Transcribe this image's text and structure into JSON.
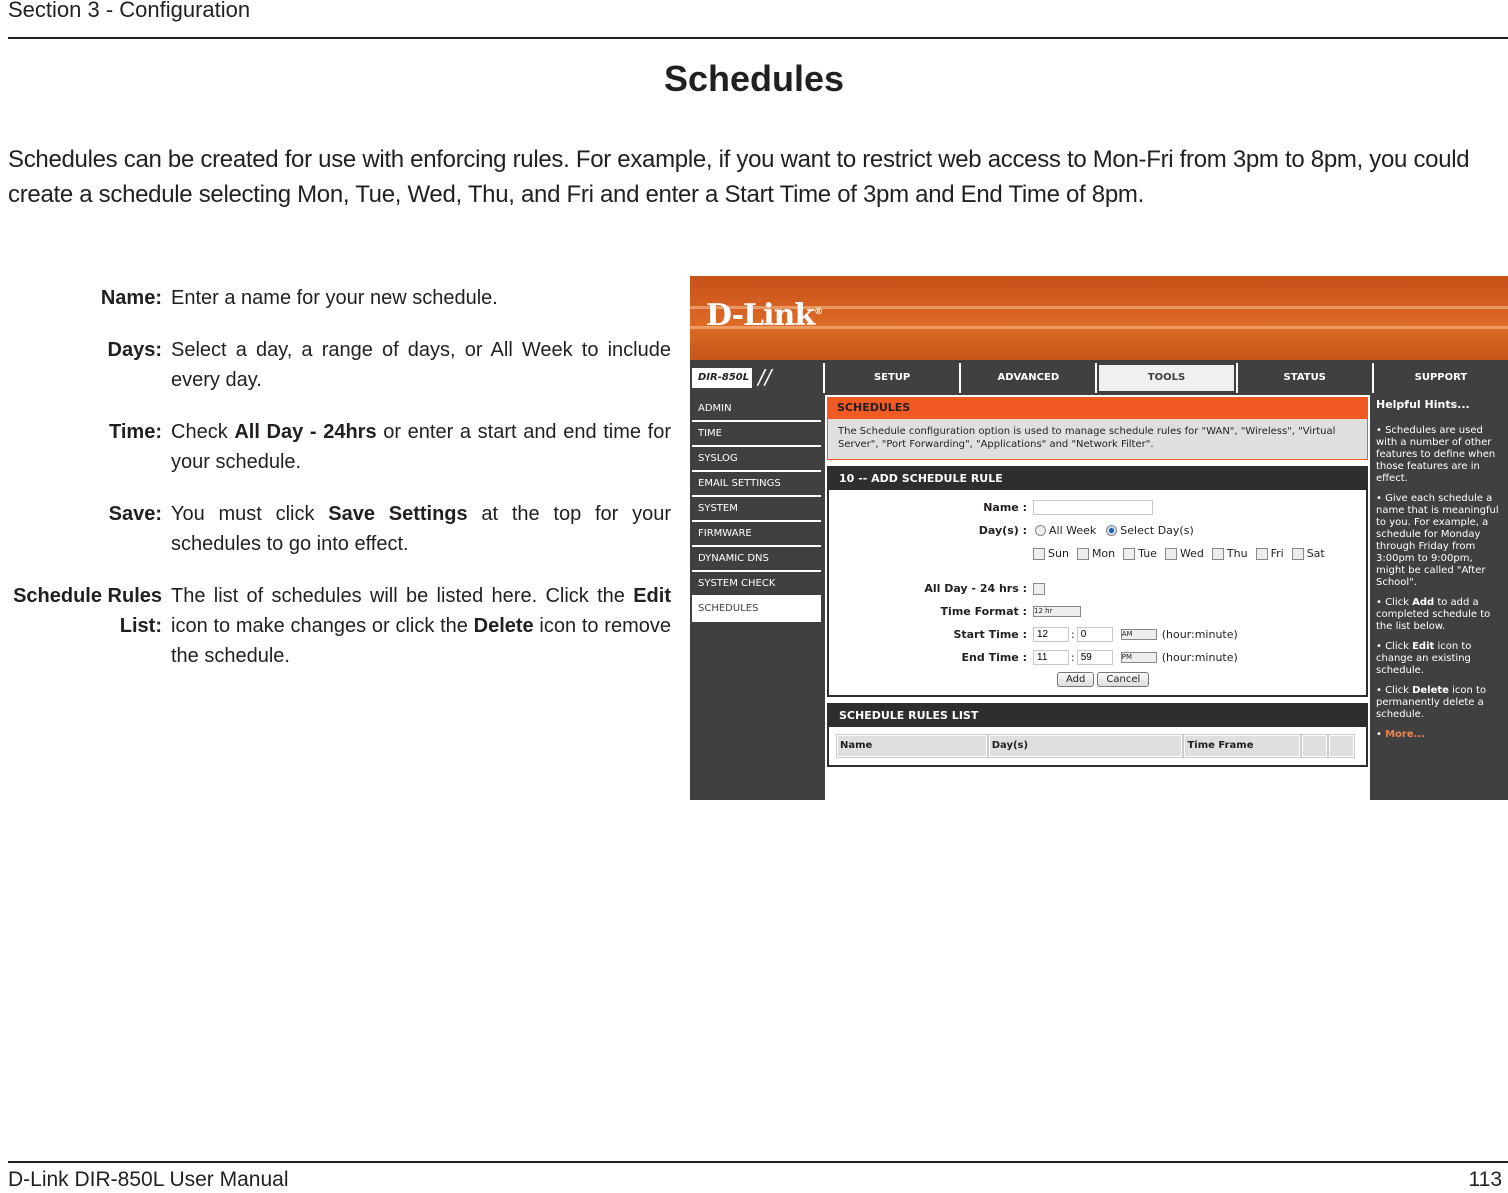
{
  "page": {
    "section_title": "Section 3 - Configuration",
    "heading": "Schedules",
    "intro": "Schedules can be created for use with enforcing rules. For example, if you want to restrict web access to Mon-Fri from 3pm to 8pm, you could create a schedule selecting Mon, Tue, Wed, Thu, and Fri and enter a Start Time of 3pm and End Time of 8pm.",
    "footer_left": "D-Link DIR-850L User Manual",
    "footer_right": "113"
  },
  "descriptions": [
    {
      "label": "Name:",
      "parts": [
        {
          "t": "Enter a name for your new schedule.",
          "b": false
        }
      ]
    },
    {
      "label": "Days:",
      "parts": [
        {
          "t": "Select a day, a range of days, or All Week to include every day.",
          "b": false
        }
      ]
    },
    {
      "label": "Time:",
      "parts": [
        {
          "t": "Check ",
          "b": false
        },
        {
          "t": "All Day - 24hrs",
          "b": true
        },
        {
          "t": " or enter a start and end time for your schedule.",
          "b": false
        }
      ]
    },
    {
      "label": "Save:",
      "parts": [
        {
          "t": "You must click ",
          "b": false
        },
        {
          "t": "Save Settings",
          "b": true
        },
        {
          "t": " at the top for your schedules to go into effect.",
          "b": false
        }
      ]
    },
    {
      "label": "Schedule Rules List:",
      "parts": [
        {
          "t": "The list of schedules will be listed here. Click the ",
          "b": false
        },
        {
          "t": "Edit",
          "b": true
        },
        {
          "t": " icon to make changes or click the ",
          "b": false
        },
        {
          "t": "Delete",
          "b": true
        },
        {
          "t": " icon to remove the schedule.",
          "b": false
        }
      ]
    }
  ],
  "router": {
    "logo": "D-Link",
    "logo_mark": "®",
    "model": "DIR-850L",
    "tabs": [
      {
        "label": "SETUP",
        "active": false
      },
      {
        "label": "ADVANCED",
        "active": false
      },
      {
        "label": "TOOLS",
        "active": true
      },
      {
        "label": "STATUS",
        "active": false
      },
      {
        "label": "SUPPORT",
        "active": false
      }
    ],
    "sidebar": [
      {
        "label": "ADMIN",
        "active": false
      },
      {
        "label": "TIME",
        "active": false
      },
      {
        "label": "SYSLOG",
        "active": false
      },
      {
        "label": "EMAIL SETTINGS",
        "active": false
      },
      {
        "label": "SYSTEM",
        "active": false
      },
      {
        "label": "FIRMWARE",
        "active": false
      },
      {
        "label": "DYNAMIC DNS",
        "active": false
      },
      {
        "label": "SYSTEM CHECK",
        "active": false
      },
      {
        "label": "SCHEDULES",
        "active": true
      }
    ],
    "schedules_box": {
      "title": "SCHEDULES",
      "text": "The Schedule configuration option is used to manage schedule rules for \"WAN\", \"Wireless\", \"Virtual Server\", \"Port Forwarding\", \"Applications\" and \"Network Filter\"."
    },
    "add_rule": {
      "title": "10 -- ADD SCHEDULE RULE",
      "name_label": "Name :",
      "name_value": "",
      "days_label": "Day(s) :",
      "all_week": "All Week",
      "select_days": "Select Day(s)",
      "days_mode": "select",
      "days": [
        {
          "label": "Sun",
          "checked": false
        },
        {
          "label": "Mon",
          "checked": false
        },
        {
          "label": "Tue",
          "checked": false
        },
        {
          "label": "Wed",
          "checked": false
        },
        {
          "label": "Thu",
          "checked": false
        },
        {
          "label": "Fri",
          "checked": false
        },
        {
          "label": "Sat",
          "checked": false
        }
      ],
      "allday_label": "All Day - 24 hrs :",
      "allday_checked": false,
      "time_format_label": "Time Format :",
      "time_format_value": "12 hr",
      "start_label": "Start Time :",
      "start_hour": "12",
      "start_minute": "0",
      "start_ampm": "AM",
      "end_label": "End Time :",
      "end_hour": "11",
      "end_minute": "59",
      "end_ampm": "PM",
      "colon": ":",
      "hint": "(hour:minute)",
      "add_button": "Add",
      "cancel_button": "Cancel"
    },
    "rules_list": {
      "title": "SCHEDULE RULES LIST",
      "columns": [
        "Name",
        "Day(s)",
        "Time Frame",
        "",
        ""
      ]
    },
    "hints": {
      "title": "Helpful Hints...",
      "items": [
        [
          {
            "t": "• Schedules are used with a number of other features to define when those features are in effect.",
            "b": false
          }
        ],
        [
          {
            "t": "• Give each schedule a name that is meaningful to you. For example, a schedule for Monday through Friday from 3:00pm to 9:00pm, might be called \"After School\".",
            "b": false
          }
        ],
        [
          {
            "t": "• Click ",
            "b": false
          },
          {
            "t": "Add",
            "b": true
          },
          {
            "t": " to add a completed schedule to the list below.",
            "b": false
          }
        ],
        [
          {
            "t": "• Click ",
            "b": false
          },
          {
            "t": "Edit",
            "b": true
          },
          {
            "t": " icon to change an existing schedule.",
            "b": false
          }
        ],
        [
          {
            "t": "• Click ",
            "b": false
          },
          {
            "t": "Delete",
            "b": true
          },
          {
            "t": " icon to permanently delete a schedule.",
            "b": false
          }
        ]
      ],
      "more": "More..."
    }
  }
}
